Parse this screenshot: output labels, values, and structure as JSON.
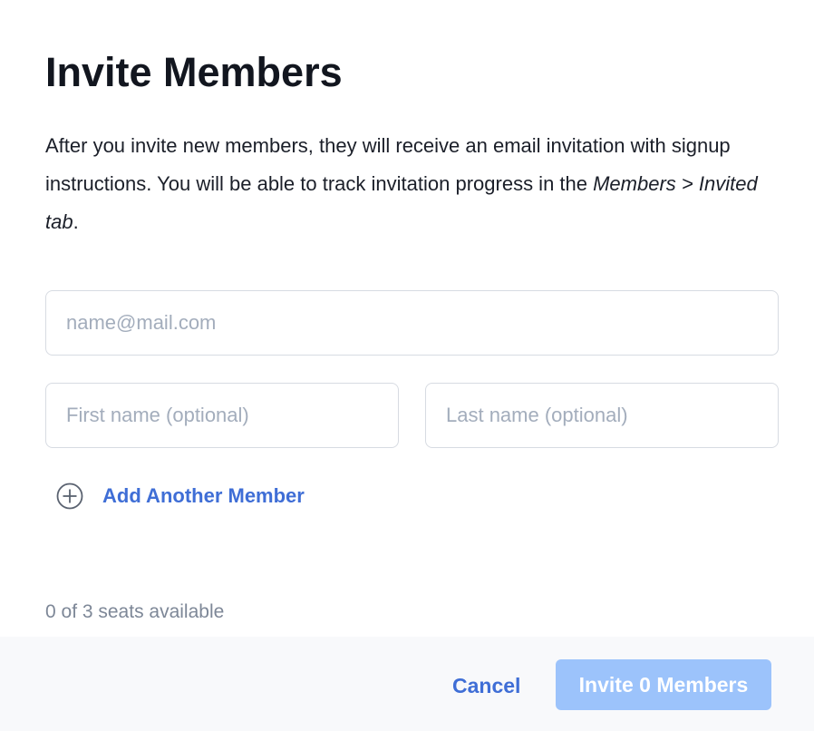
{
  "dialog": {
    "title": "Invite Members",
    "description": {
      "part1": "After you invite new members, they will receive an email invitation with signup instructions. You will be able to track invitation progress in the ",
      "emphasis": "Members > Invited tab",
      "part2": "."
    }
  },
  "form": {
    "email": {
      "placeholder": "name@mail.com",
      "value": ""
    },
    "first_name": {
      "placeholder": "First name (optional)",
      "value": ""
    },
    "last_name": {
      "placeholder": "Last name (optional)",
      "value": ""
    },
    "add_another_label": "Add Another Member",
    "add_icon": "plus-circle-icon"
  },
  "seats_text": "0 of 3 seats available",
  "footer": {
    "cancel_label": "Cancel",
    "invite_label": "Invite 0 Members",
    "invite_disabled": true
  },
  "colors": {
    "accent": "#3f6ed6",
    "invite_disabled_bg": "#9cc3fb",
    "muted_text": "#7d8797",
    "footer_bg": "#f8f9fb"
  }
}
